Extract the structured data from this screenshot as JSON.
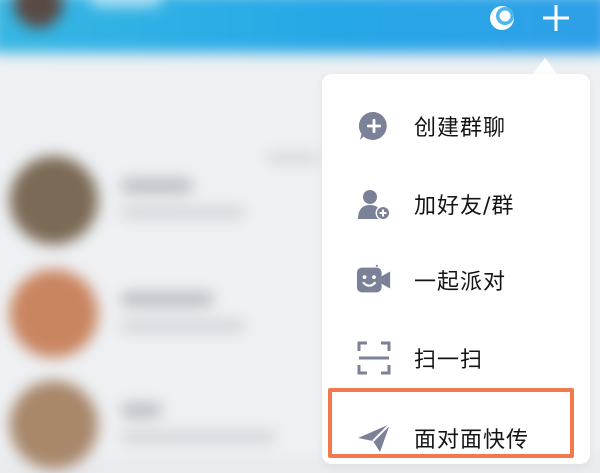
{
  "header": {
    "icons": [
      "moon-status-icon",
      "plus-icon"
    ],
    "accent": "#26a8e6"
  },
  "menu": {
    "items": [
      {
        "label": "创建群聊",
        "icon": "create-group-chat-icon"
      },
      {
        "label": "加好友/群",
        "icon": "add-friend-icon"
      },
      {
        "label": "一起派对",
        "icon": "party-video-icon"
      },
      {
        "label": "扫一扫",
        "icon": "scan-icon"
      },
      {
        "label": "面对面快传",
        "icon": "paper-plane-icon"
      }
    ],
    "highlight_color": "#f07a4e",
    "highlighted_item": "面对面快传"
  }
}
